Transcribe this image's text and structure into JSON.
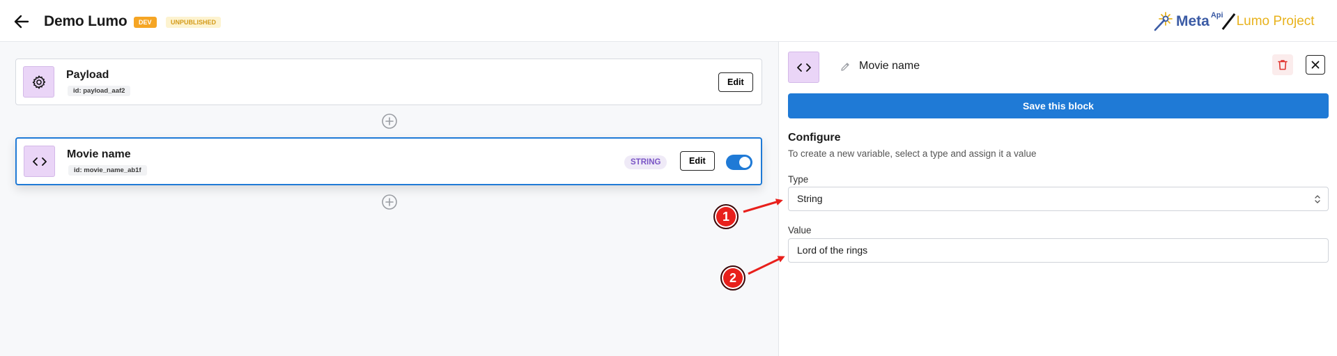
{
  "header": {
    "title": "Demo Lumo",
    "badge_dev": "DEV",
    "badge_status": "UNPUBLISHED",
    "logo_meta": "Meta",
    "logo_api": "Api",
    "logo_project": "Lumo Project"
  },
  "canvas": {
    "blocks": [
      {
        "title": "Payload",
        "id_label": "id: payload_aaf2",
        "edit_label": "Edit",
        "icon": "gear-icon"
      },
      {
        "title": "Movie name",
        "id_label": "id: movie_name_ab1f",
        "type_pill": "STRING",
        "edit_label": "Edit",
        "icon": "code-icon",
        "enabled": true
      }
    ]
  },
  "panel": {
    "block_name": "Movie name",
    "save_label": "Save this block",
    "configure_title": "Configure",
    "configure_desc": "To create a new variable, select a type and assign it a value",
    "type_label": "Type",
    "type_value": "String",
    "value_label": "Value",
    "value_value": "Lord of the rings"
  },
  "annotations": [
    "1",
    "2"
  ],
  "colors": {
    "accent": "#1f7ad6",
    "icon_bg": "#ead5f7",
    "dev_badge": "#f5a524",
    "annotation": "#e8201c",
    "trash": "#e0342f"
  }
}
